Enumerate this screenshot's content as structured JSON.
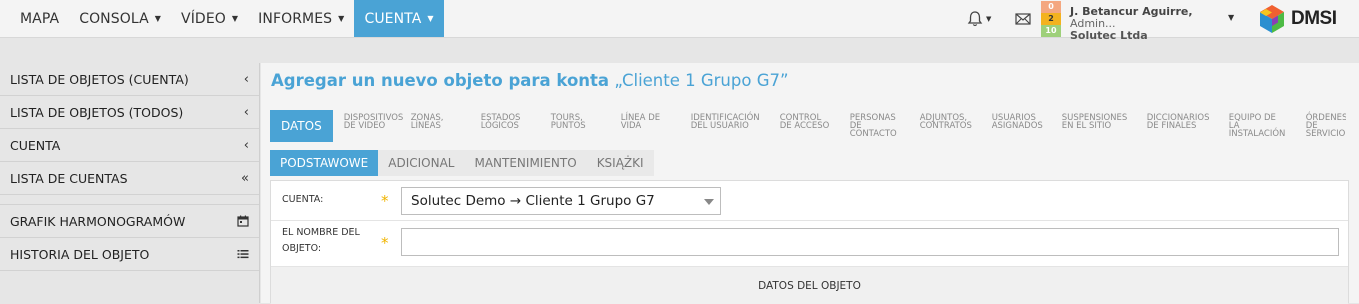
{
  "nav": {
    "items": [
      {
        "label": "MAPA",
        "has_caret": false,
        "active": false
      },
      {
        "label": "CONSOLA",
        "has_caret": true,
        "active": false
      },
      {
        "label": "VÍDEO",
        "has_caret": true,
        "active": false
      },
      {
        "label": "INFORMES",
        "has_caret": true,
        "active": false
      },
      {
        "label": "CUENTA",
        "has_caret": true,
        "active": true
      }
    ]
  },
  "header": {
    "bell_icon": "bell-icon",
    "envelope_icon": "envelope-icon",
    "counters": [
      "0",
      "2",
      "10"
    ],
    "counter_colors": [
      "#f4a780",
      "#f3b21f",
      "#9ed07a"
    ],
    "user_name": "J. Betancur Aguirre,",
    "user_role": "Admin...",
    "user_org": "Solutec Ltda",
    "logo_text": "DMSI"
  },
  "sidebar": {
    "items": [
      {
        "label": "LISTA DE OBJETOS (CUENTA)",
        "icon": "‹",
        "icon_name": "chevron-left-icon"
      },
      {
        "label": "LISTA DE OBJETOS (TODOS)",
        "icon": "‹",
        "icon_name": "chevron-left-icon"
      },
      {
        "label": "CUENTA",
        "icon": "‹",
        "icon_name": "chevron-left-icon"
      },
      {
        "label": "LISTA DE CUENTAS",
        "icon": "«",
        "icon_name": "double-chevron-left-icon"
      },
      {
        "label": "GRAFIK HARMONOGRAMÓW",
        "icon": "▣",
        "icon_name": "calendar-icon"
      },
      {
        "label": "HISTORIA DEL OBJETO",
        "icon": "≣",
        "icon_name": "list-icon"
      }
    ]
  },
  "main": {
    "title_prefix": "Agregar un nuevo objeto para konta",
    "title_object": "„Cliente 1 Grupo G7”",
    "tabs": [
      {
        "line1": "DATOS",
        "line2": "",
        "line3": "",
        "active": true
      },
      {
        "line1": "DISPOSITIVOS",
        "line2": "DE VIDEO",
        "line3": ""
      },
      {
        "line1": "ZONAS,",
        "line2": "LÍNEAS",
        "line3": ""
      },
      {
        "line1": "ESTADOS",
        "line2": "LÓGICOS",
        "line3": ""
      },
      {
        "line1": "TOURS,",
        "line2": "PUNTOS",
        "line3": ""
      },
      {
        "line1": "LÍNEA DE",
        "line2": "VIDA",
        "line3": ""
      },
      {
        "line1": "IDENTIFICACIÓN",
        "line2": "DEL USUARIO",
        "line3": ""
      },
      {
        "line1": "CONTROL",
        "line2": "DE ACCESO",
        "line3": ""
      },
      {
        "line1": "PERSONAS",
        "line2": "DE",
        "line3": "CONTACTO"
      },
      {
        "line1": "ADJUNTOS,",
        "line2": "CONTRATOS",
        "line3": ""
      },
      {
        "line1": "USUARIOS",
        "line2": "ASIGNADOS",
        "line3": ""
      },
      {
        "line1": "SUSPENSIONES",
        "line2": "EN EL SITIO",
        "line3": ""
      },
      {
        "line1": "DICCIONARIOS",
        "line2": "DE FINALES",
        "line3": ""
      },
      {
        "line1": "EQUIPO DE",
        "line2": "LA",
        "line3": "INSTALACIÓN"
      },
      {
        "line1": "ÓRDENES",
        "line2": "DE",
        "line3": "SERVICIO"
      }
    ],
    "subtabs": [
      {
        "label": "PODSTAWOWE",
        "active": true
      },
      {
        "label": "ADICIONAL",
        "active": false
      },
      {
        "label": "MANTENIMIENTO",
        "active": false
      },
      {
        "label": "KSIĄŻKI",
        "active": false
      }
    ],
    "form": {
      "account_label": "CUENTA:",
      "account_value": "Solutec Demo → Cliente 1 Grupo G7",
      "name_label_1": "EL NOMBRE DEL",
      "name_label_2": "OBJETO:",
      "name_value": "",
      "required_mark": "*",
      "section_title": "DATOS DEL OBJETO"
    }
  }
}
